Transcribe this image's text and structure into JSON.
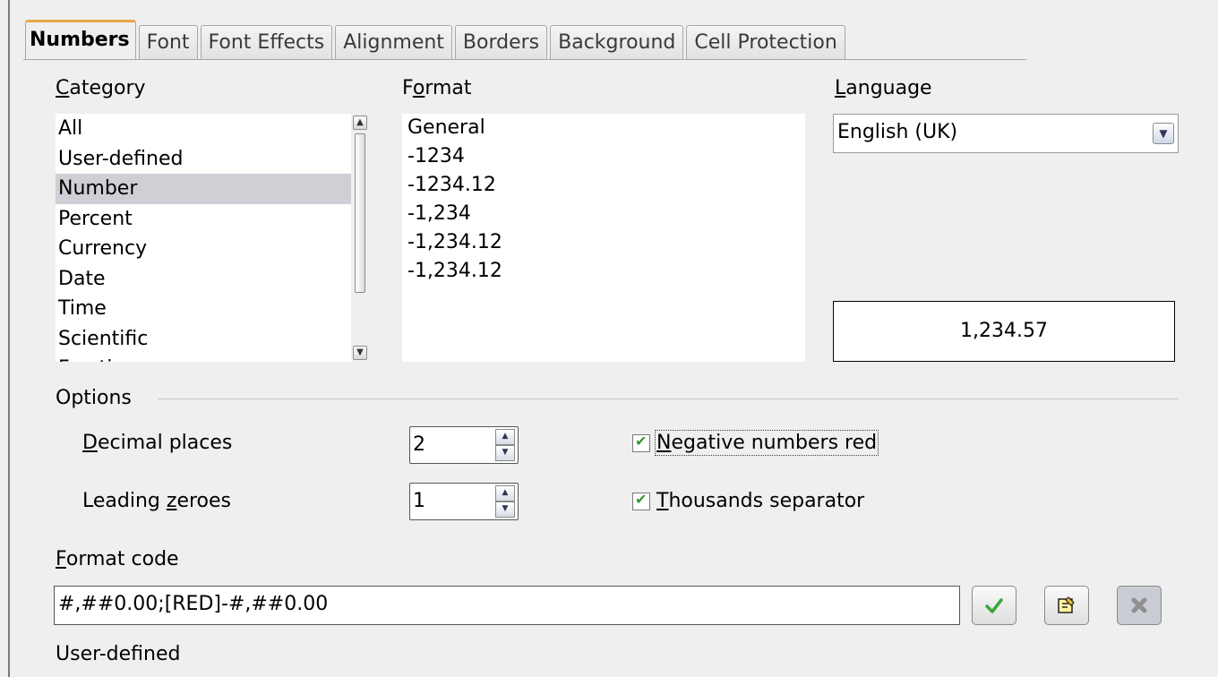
{
  "tabs": [
    "Numbers",
    "Font",
    "Font Effects",
    "Alignment",
    "Borders",
    "Background",
    "Cell Protection"
  ],
  "category": {
    "label_pre": "",
    "label_u": "C",
    "label_post": "ategory",
    "items": [
      "All",
      "User-defined",
      "Number",
      "Percent",
      "Currency",
      "Date",
      "Time",
      "Scientific",
      "Fraction"
    ],
    "selected": "Number"
  },
  "format": {
    "label_pre": "F",
    "label_u": "o",
    "label_post": "rmat",
    "items": [
      "General",
      "-1234",
      "-1234.12",
      "-1,234",
      "-1,234.12",
      "-1,234.12"
    ]
  },
  "language": {
    "label_pre": "",
    "label_u": "L",
    "label_post": "anguage",
    "value": "English (UK)"
  },
  "preview": "1,234.57",
  "options": {
    "title": "Options",
    "decimal_label_u": "D",
    "decimal_label_post": "ecimal places",
    "decimal_value": "2",
    "leading_label_pre": "Leading ",
    "leading_label_u": "z",
    "leading_label_post": "eroes",
    "leading_value": "1",
    "negative_red_u": "N",
    "negative_red_post": "egative numbers red",
    "negative_red_checked": true,
    "thousands_u": "T",
    "thousands_post": "housands separator",
    "thousands_checked": true
  },
  "format_code": {
    "label_u": "F",
    "label_post": "ormat code",
    "value": "#,##0.00;[RED]-#,##0.00"
  },
  "status": "User-defined",
  "icons": [
    "checkmark-icon",
    "edit-comment-icon",
    "delete-icon"
  ],
  "colors": {
    "accent": "#e8a84a",
    "selection": "#cfcfd6",
    "check": "#2f9a2f"
  }
}
